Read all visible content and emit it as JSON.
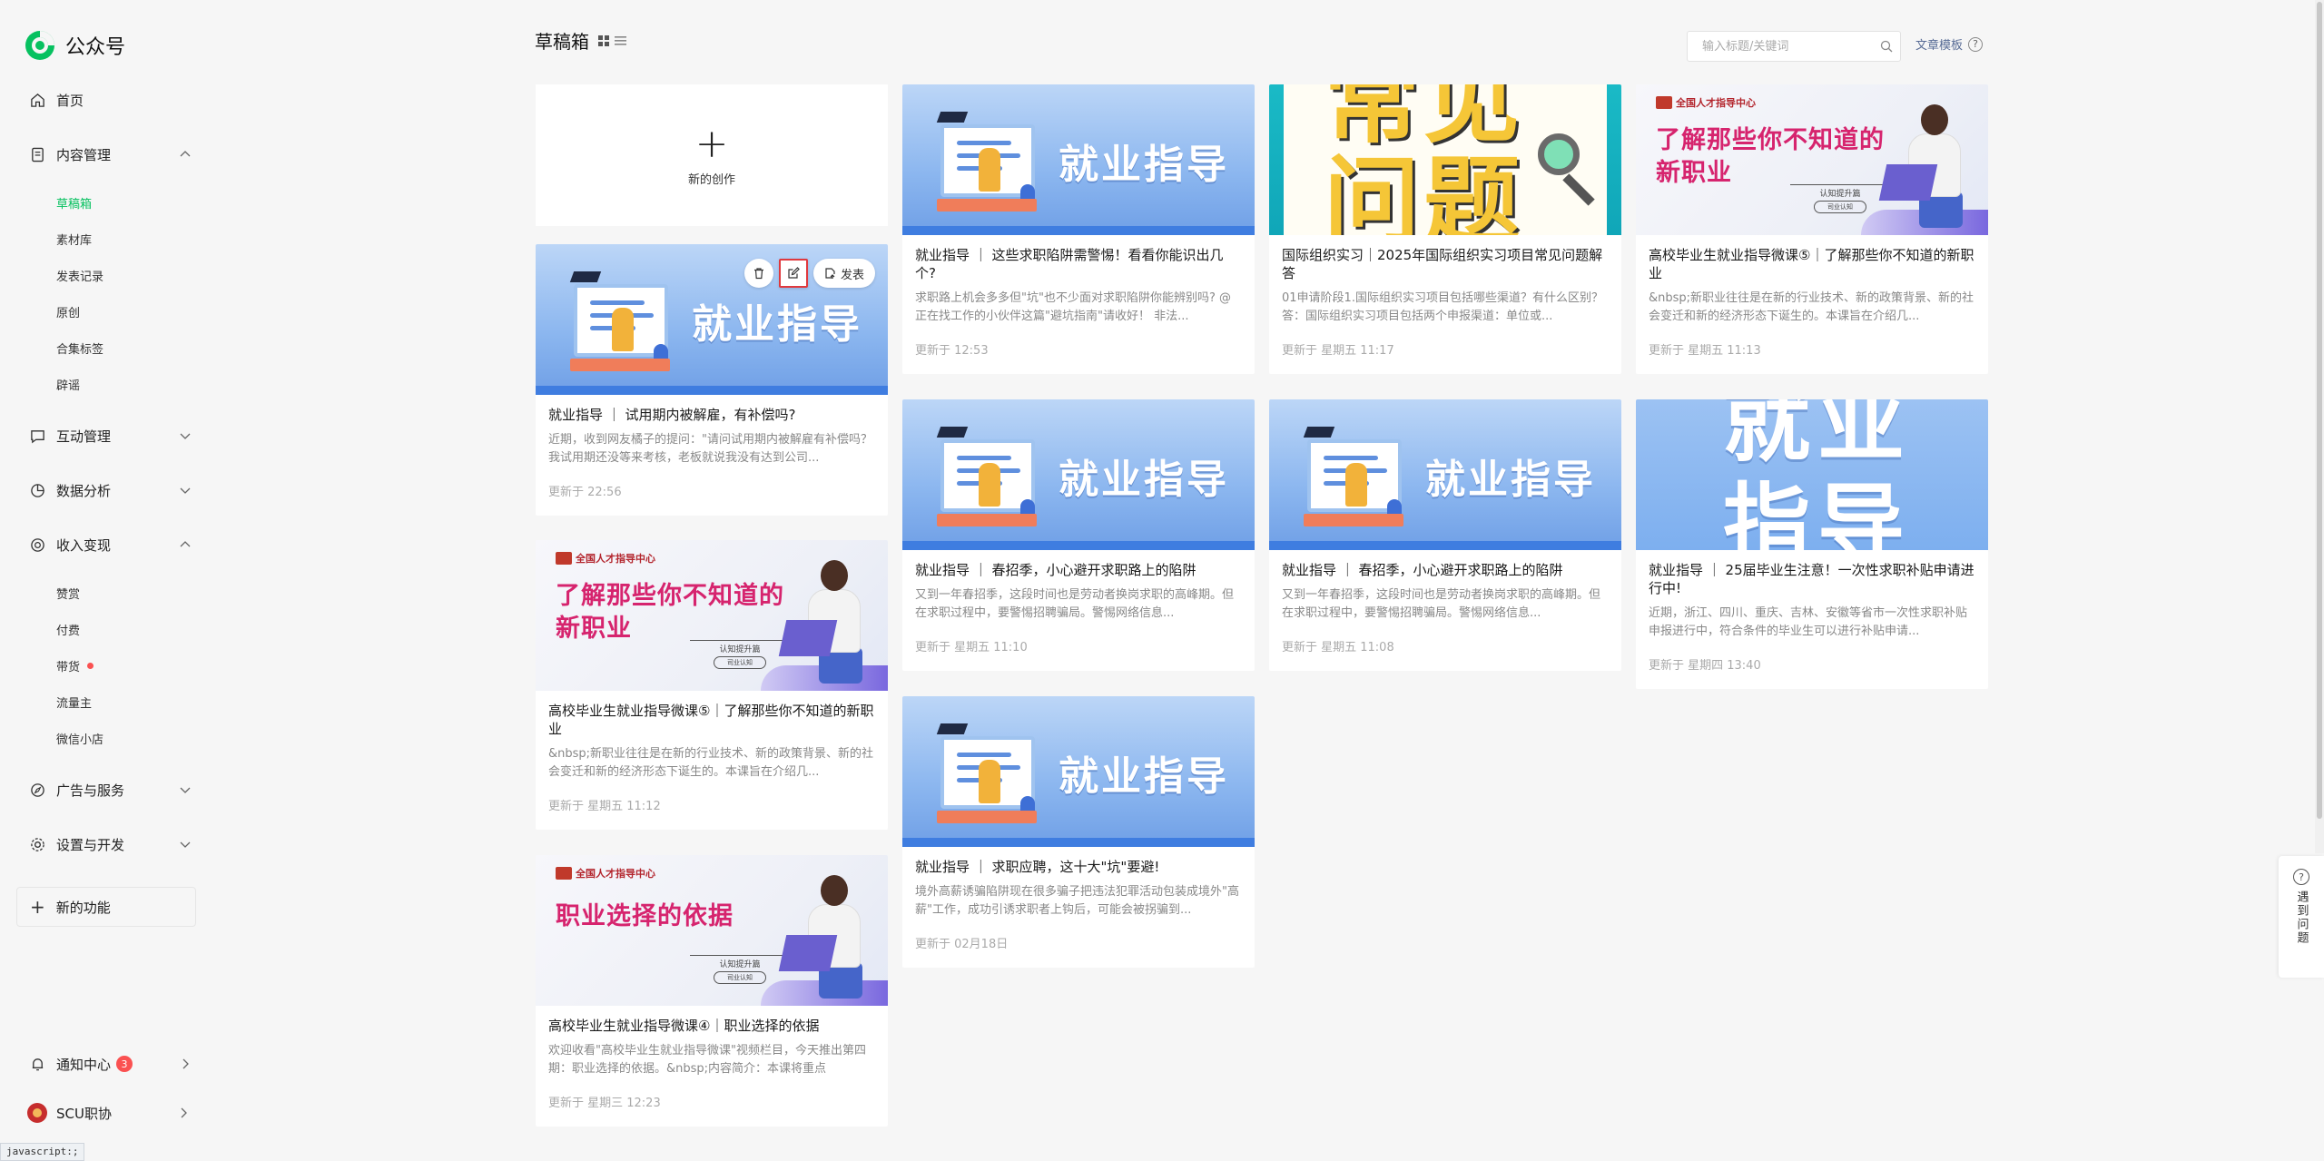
{
  "app": {
    "name": "公众号",
    "brand_color": "#07c160"
  },
  "sidebar": {
    "home": "首页",
    "content_mgmt": "内容管理",
    "content_sub": [
      "草稿箱",
      "素材库",
      "发表记录",
      "原创",
      "合集标签",
      "辟谣"
    ],
    "interaction": "互动管理",
    "data_analysis": "数据分析",
    "monetize": "收入变现",
    "monetize_sub": [
      "赞赏",
      "付费",
      "带货",
      "流量主",
      "微信小店"
    ],
    "ads": "广告与服务",
    "settings": "设置与开发",
    "new_features": "新的功能",
    "notify": "通知中心",
    "notify_count": "3",
    "account": "SCU职协"
  },
  "header": {
    "title": "草稿箱",
    "search_placeholder": "输入标题/关键词",
    "template_link": "文章模板"
  },
  "new_card": {
    "label": "新的创作"
  },
  "hover_tools": {
    "publish": "发表"
  },
  "covers": {
    "guide": "就业指导",
    "pink_org": "全国人才指导中心",
    "pink_new": "了解那些你不知道的新职业",
    "pink_choice": "职业选择的依据",
    "pink_sub1": "认知提升篇",
    "pink_sub2": "认知提升篇",
    "pink_pill": "司业认知",
    "faq": "常见问题",
    "big": "就业指导"
  },
  "cards": [
    {
      "title": "就业指导 ｜ 试用期内被解雇，有补偿吗?",
      "desc": "近期，收到网友橘子的提问：\"请问试用期内被解雇有补偿吗？我试用期还没等来考核，老板就说我没有达到公司...",
      "time": "更新于 22:56"
    },
    {
      "title": "高校毕业生就业指导微课⑤｜了解那些你不知道的新职业",
      "desc": "&nbsp;新职业往往是在新的行业技术、新的政策背景、新的社会变迁和新的经济形态下诞生的。本课旨在介绍几...",
      "time": "更新于 星期五 11:12"
    },
    {
      "title": "高校毕业生就业指导微课④｜职业选择的依据",
      "desc": "欢迎收看\"高校毕业生就业指导微课\"视频栏目，今天推出第四期：职业选择的依据。&nbsp;内容简介：本课将重点",
      "time": "更新于 星期三 12:23"
    },
    {
      "title": "就业指导 ｜ 这些求职陷阱需警惕！看看你能识出几个?",
      "desc": "求职路上机会多多但\"坑\"也不少面对求职陷阱你能辨别吗? @正在找工作的小伙伴这篇\"避坑指南\"请收好！ 非法...",
      "time": "更新于 12:53"
    },
    {
      "title": "就业指导 ｜ 春招季，小心避开求职路上的陷阱",
      "desc": "又到一年春招季，这段时间也是劳动者换岗求职的高峰期。但在求职过程中，要警惕招聘骗局。警惕网络信息...",
      "time": "更新于 星期五 11:10"
    },
    {
      "title": "就业指导 ｜ 求职应聘，这十大\"坑\"要避!",
      "desc": "境外高薪诱骗陷阱现在很多骗子把违法犯罪活动包装成境外\"高薪\"工作，成功引诱求职者上钩后，可能会被拐骗到...",
      "time": "更新于 02月18日"
    },
    {
      "title": "国际组织实习｜2025年国际组织实习项目常见问题解答",
      "desc": "01申请阶段1.国际组织实习项目包括哪些渠道？有什么区别？答：国际组织实习项目包括两个申报渠道：单位或...",
      "time": "更新于 星期五 11:17"
    },
    {
      "title": "就业指导 ｜ 春招季，小心避开求职路上的陷阱",
      "desc": "又到一年春招季，这段时间也是劳动者换岗求职的高峰期。但在求职过程中，要警惕招聘骗局。警惕网络信息...",
      "time": "更新于 星期五 11:08"
    },
    {
      "title": "高校毕业生就业指导微课⑤｜了解那些你不知道的新职业",
      "desc": "&nbsp;新职业往往是在新的行业技术、新的政策背景、新的社会变迁和新的经济形态下诞生的。本课旨在介绍几...",
      "time": "更新于 星期五 11:13"
    },
    {
      "title": "就业指导 ｜ 25届毕业生注意！一次性求职补贴申请进行中!",
      "desc": "近期，浙江、四川、重庆、吉林、安徽等省市一次性求职补贴申报进行中，符合条件的毕业生可以进行补贴申请...",
      "time": "更新于 星期四 13:40"
    }
  ],
  "feedback": {
    "label": "遇到问题"
  },
  "statusbar": "javascript:;"
}
